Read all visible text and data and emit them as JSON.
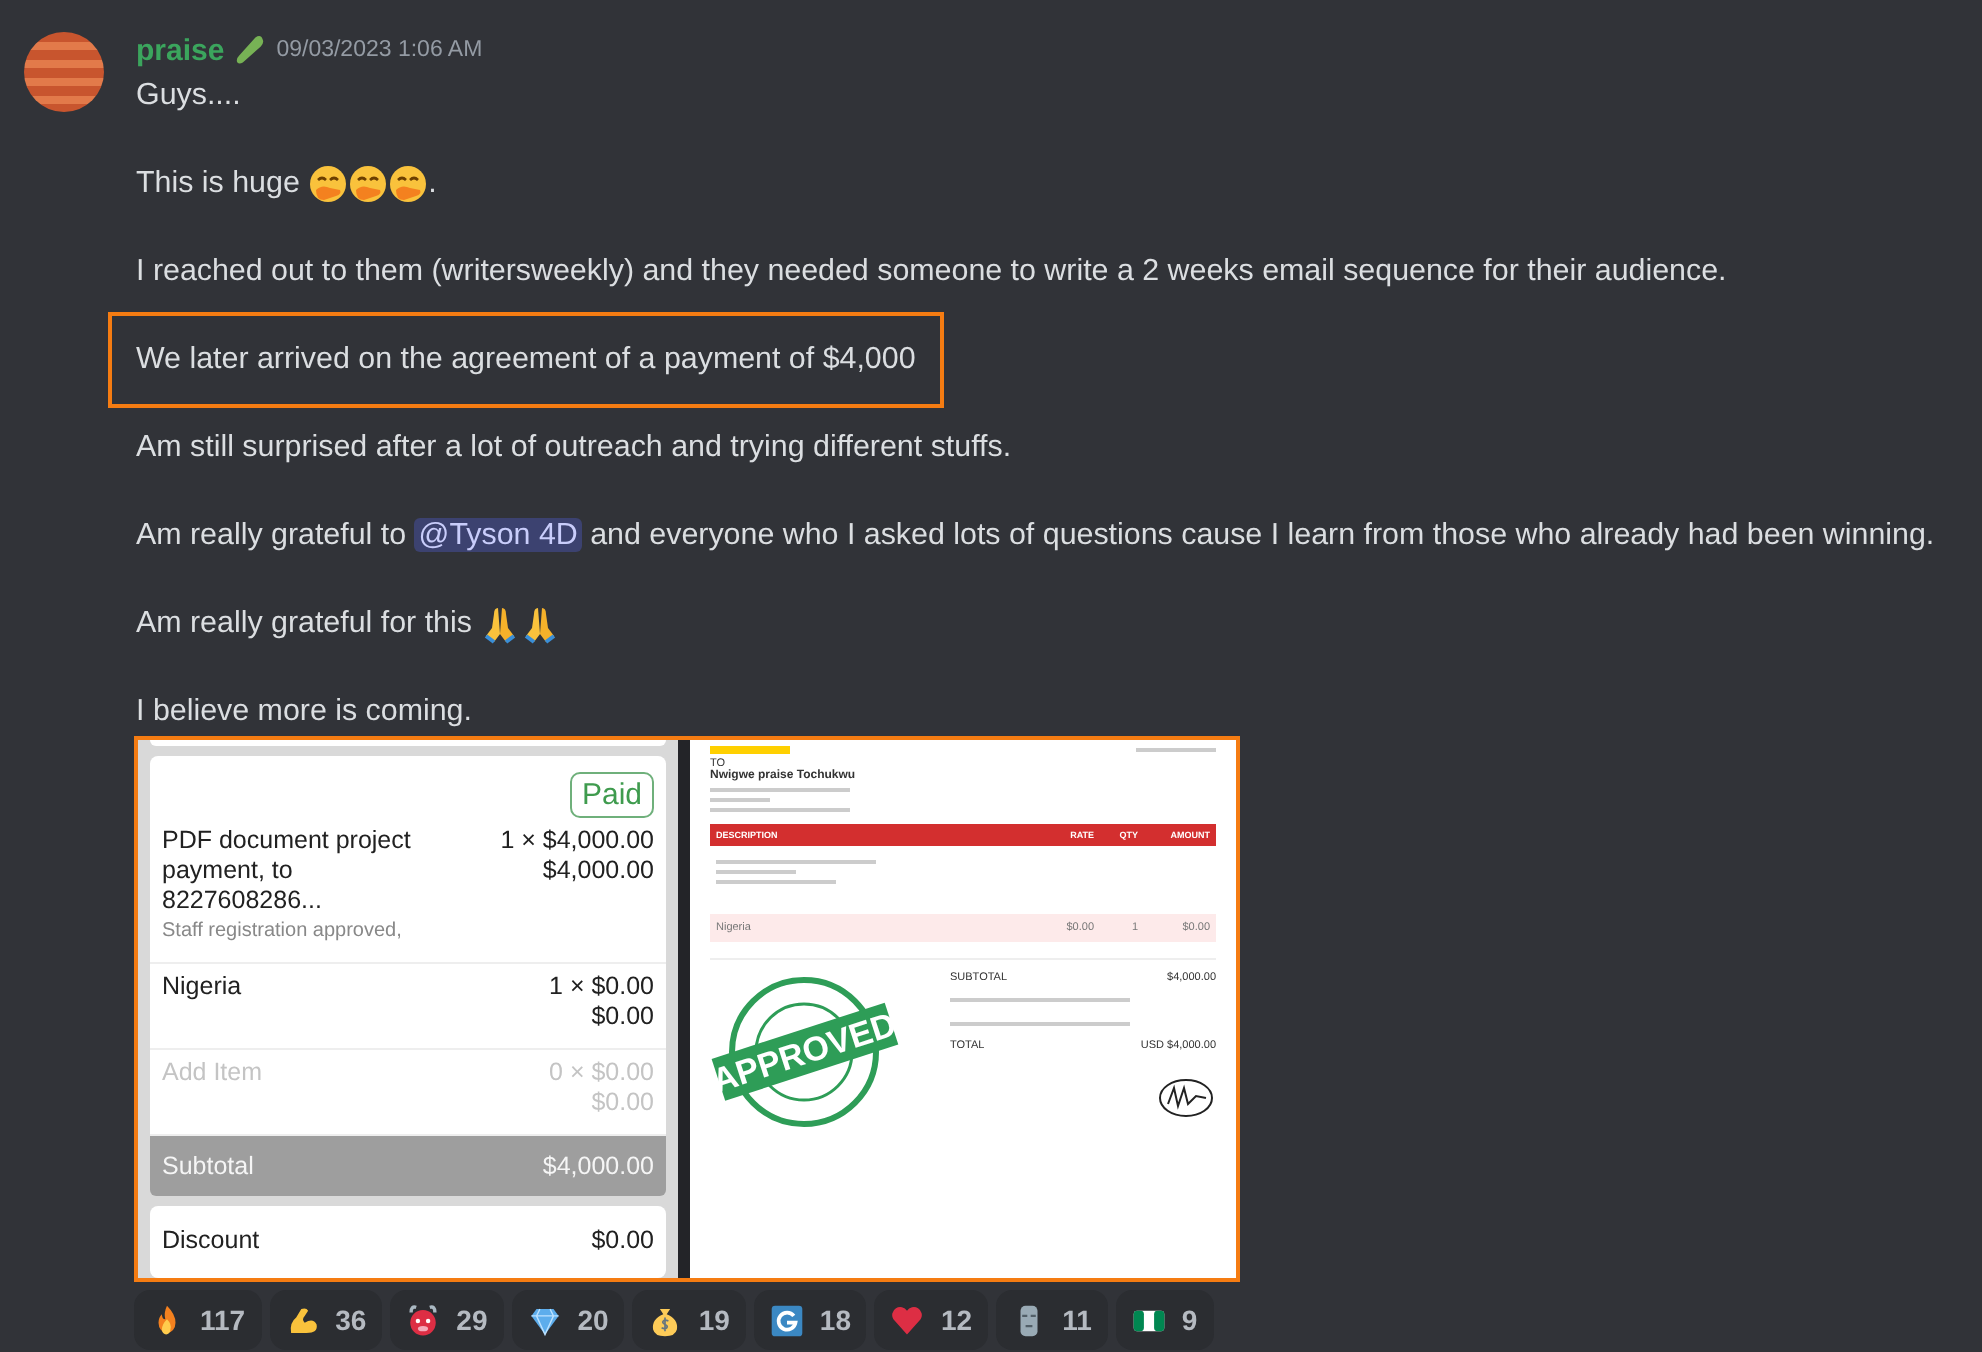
{
  "message": {
    "author": "praise",
    "timestamp": "09/03/2023 1:06 AM",
    "lines": [
      {
        "parts": [
          {
            "kind": "text",
            "text": "Guys...."
          }
        ]
      },
      {
        "parts": [
          {
            "kind": "text",
            "text": "This is huge"
          },
          {
            "kind": "hand-over-mouth"
          },
          {
            "kind": "hand-over-mouth"
          },
          {
            "kind": "hand-over-mouth"
          },
          {
            "kind": "suffix",
            "text": "."
          }
        ]
      },
      {
        "parts": [
          {
            "kind": "text",
            "text": "I reached out to them (writersweekly) and they needed someone to write a 2 weeks email sequence for their audience."
          }
        ]
      },
      {
        "parts": [
          {
            "kind": "text",
            "text": "We later arrived on the agreement of a payment of $4,000"
          }
        ],
        "highlighted": true
      },
      {
        "parts": [
          {
            "kind": "text",
            "text": "Am still surprised after a lot of outreach and trying different stuffs."
          }
        ]
      },
      {
        "parts": [
          {
            "kind": "text",
            "text": "Am really grateful to"
          },
          {
            "kind": "mention",
            "text": "@Tyson 4D"
          },
          {
            "kind": "text",
            "text": "and everyone who I asked lots of questions cause I learn from those who already had been winning."
          }
        ]
      },
      {
        "parts": [
          {
            "kind": "text",
            "text": "Am really grateful for this"
          },
          {
            "kind": "praying-hands"
          },
          {
            "kind": "praying-hands"
          }
        ]
      },
      {
        "parts": [
          {
            "kind": "text",
            "text": "I believe more is coming."
          }
        ]
      }
    ],
    "attachment": {
      "highlighted": true,
      "left": {
        "badge": "Paid",
        "items": [
          {
            "name": "PDF document project payment, to 8227608286...",
            "note": "Staff registration approved,",
            "quantity": "1 × $4,000.00",
            "total": "$4,000.00",
            "disabled": false
          },
          {
            "name": "Nigeria",
            "quantity": "1 × $0.00",
            "total": "$0.00",
            "disabled": false
          },
          {
            "name": "Add Item",
            "quantity": "0 × $0.00",
            "total": "$0.00",
            "disabled": true
          }
        ],
        "subtotal": {
          "label": "Subtotal",
          "value": "$4,000.00"
        },
        "discount": {
          "label": "Discount",
          "value": "$0.00"
        }
      },
      "right": {
        "to_label": "TO",
        "recipient": "Nwigwe praise Tochukwu",
        "columns": [
          "DESCRIPTION",
          "RATE",
          "QTY",
          "AMOUNT"
        ],
        "row": {
          "name": "Nigeria",
          "rate": "$0.00",
          "qty": "1",
          "amount": "$0.00"
        },
        "subtotal": {
          "label": "SUBTOTAL",
          "value": "$4,000.00"
        },
        "total": {
          "label": "TOTAL",
          "value": "USD $4,000.00"
        },
        "stamp": "APPROVED"
      }
    },
    "reactions": [
      {
        "kind": "fire",
        "count": "117"
      },
      {
        "kind": "biceps",
        "count": "36"
      },
      {
        "kind": "ox-face",
        "count": "29"
      },
      {
        "kind": "gem",
        "count": "20"
      },
      {
        "kind": "money-bag",
        "count": "19"
      },
      {
        "kind": "letter-tile",
        "count": "18"
      },
      {
        "kind": "heart",
        "count": "12"
      },
      {
        "kind": "stone-head",
        "count": "11"
      },
      {
        "kind": "flag",
        "count": "9"
      }
    ]
  }
}
